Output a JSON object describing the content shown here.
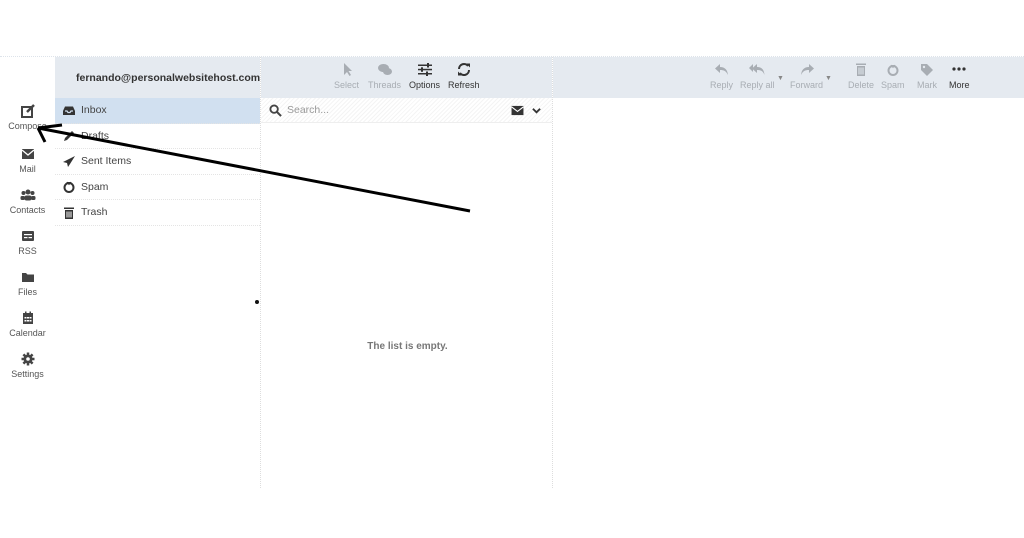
{
  "nav": {
    "items": [
      {
        "label": "Compose",
        "icon": "compose-icon"
      },
      {
        "label": "Mail",
        "icon": "mail-icon"
      },
      {
        "label": "Contacts",
        "icon": "contacts-icon"
      },
      {
        "label": "RSS",
        "icon": "rss-icon"
      },
      {
        "label": "Files",
        "icon": "folder-icon"
      },
      {
        "label": "Calendar",
        "icon": "calendar-icon"
      },
      {
        "label": "Settings",
        "icon": "gear-icon"
      }
    ]
  },
  "account": {
    "email": "fernando@personalwebsitehost.com"
  },
  "folders": [
    {
      "label": "Inbox",
      "icon": "inbox-icon",
      "active": true
    },
    {
      "label": "Drafts",
      "icon": "pencil-icon"
    },
    {
      "label": "Sent Items",
      "icon": "paper-plane-icon"
    },
    {
      "label": "Spam",
      "icon": "spam-icon"
    },
    {
      "label": "Trash",
      "icon": "trash-icon"
    }
  ],
  "list_toolbar": {
    "select": "Select",
    "threads": "Threads",
    "options": "Options",
    "refresh": "Refresh"
  },
  "search": {
    "placeholder": "Search...",
    "value": ""
  },
  "list": {
    "empty_message": "The list is empty."
  },
  "message_toolbar": {
    "reply": "Reply",
    "reply_all": "Reply all",
    "forward": "Forward",
    "delete": "Delete",
    "spam": "Spam",
    "mark": "Mark",
    "more": "More"
  },
  "colors": {
    "header_bg": "#e5eaf0",
    "active_folder_bg": "#d1e0f0",
    "annotation_arrow": "#000000"
  }
}
